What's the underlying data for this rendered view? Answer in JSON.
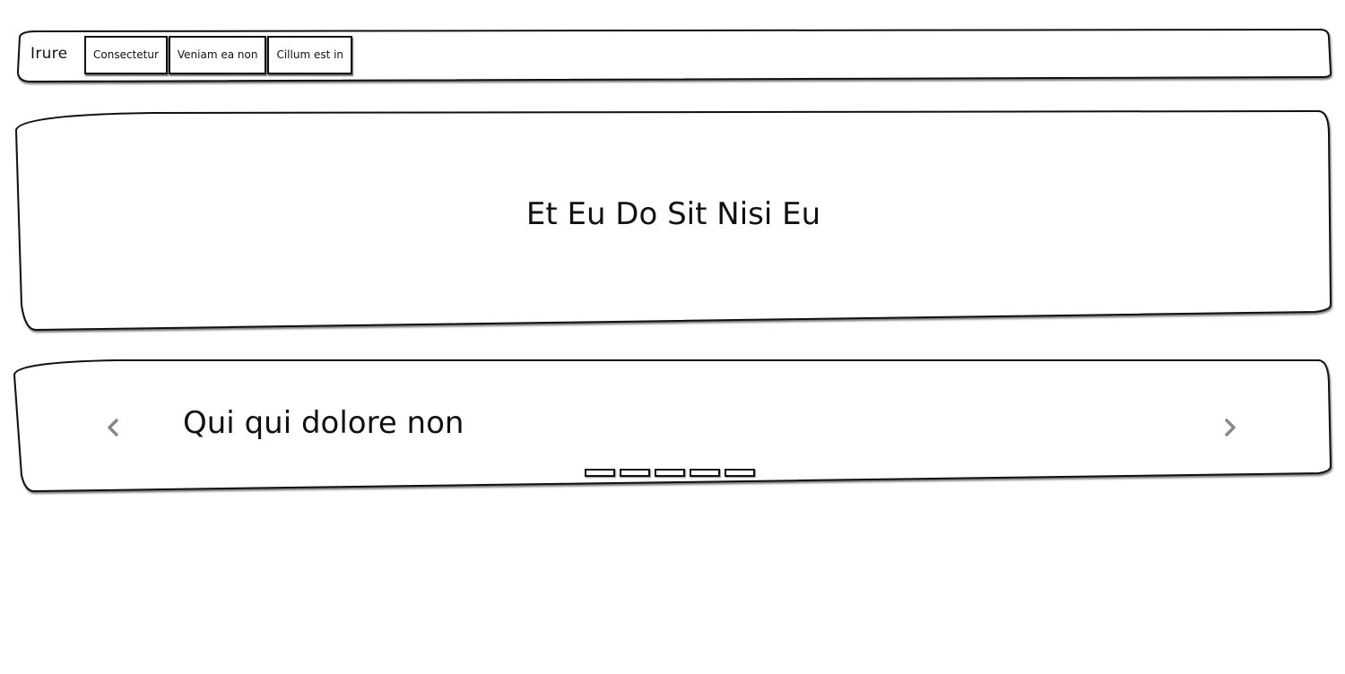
{
  "navbar": {
    "brand": "Irure",
    "items": [
      {
        "label": "Consectetur"
      },
      {
        "label": "Veniam ea non"
      },
      {
        "label": "Cillum est in"
      }
    ]
  },
  "hero": {
    "title": "Et Eu Do Sit Nisi Eu"
  },
  "carousel": {
    "caption": "Qui qui dolore non",
    "prev_icon": "chevron-left-icon",
    "next_icon": "chevron-right-icon",
    "slide_count": 5
  },
  "colors": {
    "ink": "#111111",
    "background": "#ffffff",
    "arrow": "#888888"
  }
}
